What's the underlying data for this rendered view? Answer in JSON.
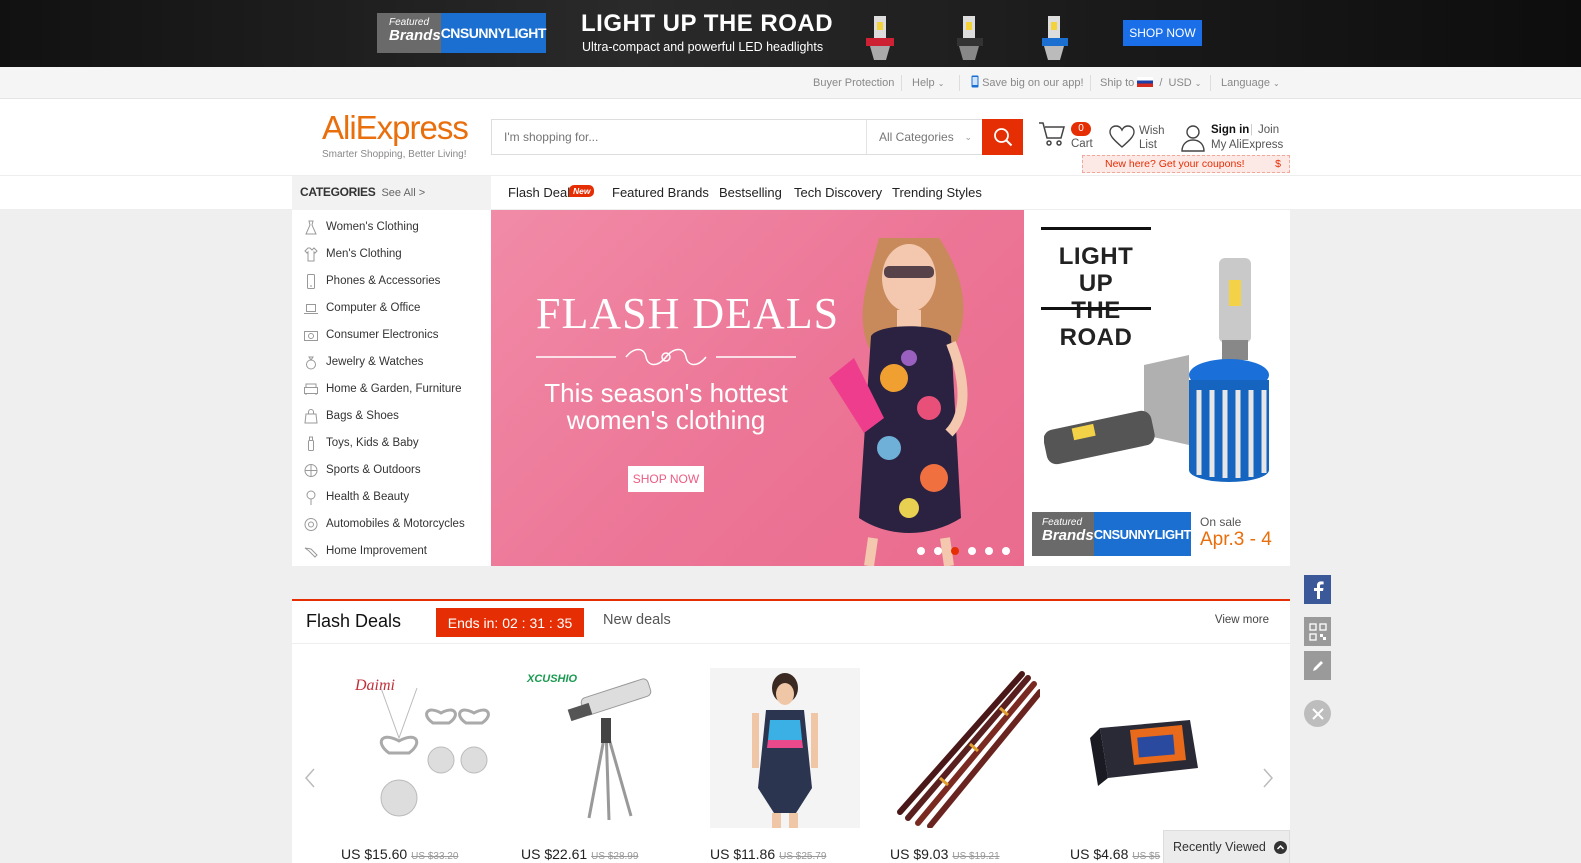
{
  "colors": {
    "accent": "#e62e04",
    "brand_orange": "#f07c14",
    "brand_blue": "#1a6fd0",
    "hero_pink": "#ec7596"
  },
  "top_banner": {
    "brand_featured_small": "Featured",
    "brand_featured_big": "Brands",
    "brand_name": "CNSUNNYLIGHT",
    "title": "LIGHT UP THE ROAD",
    "subtitle": "Ultra-compact and powerful  LED headlights",
    "shop_now": "SHOP NOW"
  },
  "utility": {
    "buyer_protection": "Buyer Protection",
    "help": "Help",
    "app": "Save big on our app!",
    "ship_to": "Ship to",
    "currency": "USD",
    "language": "Language"
  },
  "header": {
    "logo": "AliExpress",
    "tagline": "Smarter Shopping, Better Living!",
    "search_placeholder": "I'm shopping for...",
    "search_category": "All Categories",
    "cart_count": "0",
    "cart_label": "Cart",
    "wish_line1": "Wish",
    "wish_line2": "List",
    "sign_in": "Sign in",
    "join": "Join",
    "my_account": "My AliExpress",
    "coupon": "New here? Get your coupons!",
    "coupon_symbol": "$"
  },
  "nav": {
    "categories": "CATEGORIES",
    "see_all": "See All >",
    "links": [
      "Flash Deals",
      "Featured Brands",
      "Bestselling",
      "Tech Discovery",
      "Trending Styles"
    ],
    "new_tag": "New"
  },
  "categories": [
    {
      "label": "Women's Clothing",
      "icon": "dress-icon"
    },
    {
      "label": "Men's Clothing",
      "icon": "shirt-icon"
    },
    {
      "label": "Phones & Accessories",
      "icon": "phone-icon"
    },
    {
      "label": "Computer & Office",
      "icon": "laptop-icon"
    },
    {
      "label": "Consumer Electronics",
      "icon": "camera-icon"
    },
    {
      "label": "Jewelry & Watches",
      "icon": "ring-icon"
    },
    {
      "label": "Home & Garden, Furniture",
      "icon": "sofa-icon"
    },
    {
      "label": "Bags & Shoes",
      "icon": "bag-icon"
    },
    {
      "label": "Toys, Kids & Baby",
      "icon": "bottle-icon"
    },
    {
      "label": "Sports & Outdoors",
      "icon": "ball-icon"
    },
    {
      "label": "Health & Beauty",
      "icon": "beauty-icon"
    },
    {
      "label": "Automobiles & Motorcycles",
      "icon": "wheel-icon"
    },
    {
      "label": "Home Improvement",
      "icon": "tool-icon"
    }
  ],
  "hero": {
    "title": "FLASH DEALS",
    "subtitle_line1": "This season's hottest",
    "subtitle_line2": "women's clothing",
    "button": "SHOP NOW",
    "active_slide": 3,
    "slide_count": 6
  },
  "promo": {
    "title_line1": "LIGHT UP",
    "title_line2": "THE ROAD",
    "brand_featured_small": "Featured",
    "brand_featured_big": "Brands",
    "brand_name": "CNSUNNYLIGHT",
    "on_sale": "On sale",
    "dates": "Apr.3 - 4"
  },
  "flash_deals": {
    "title": "Flash Deals",
    "timer": "Ends in: 02 : 31 : 35",
    "new_deals": "New deals",
    "view_more": "View more",
    "products": [
      {
        "name": "pearl-jewelry-set",
        "price": "US $15.60",
        "old": "US $33.20",
        "brand_mark": "Daimi"
      },
      {
        "name": "telescope",
        "price": "US $22.61",
        "old": "US $28.99",
        "brand_mark": "XCUSHIO"
      },
      {
        "name": "swimsuit",
        "price": "US $11.86",
        "old": "US $25.79"
      },
      {
        "name": "fishing-rod",
        "price": "US $9.03",
        "old": "US $19.21"
      },
      {
        "name": "obd-scanner",
        "price": "US $4.68",
        "old": "US $5"
      }
    ],
    "recently_viewed": "Recently Viewed"
  }
}
